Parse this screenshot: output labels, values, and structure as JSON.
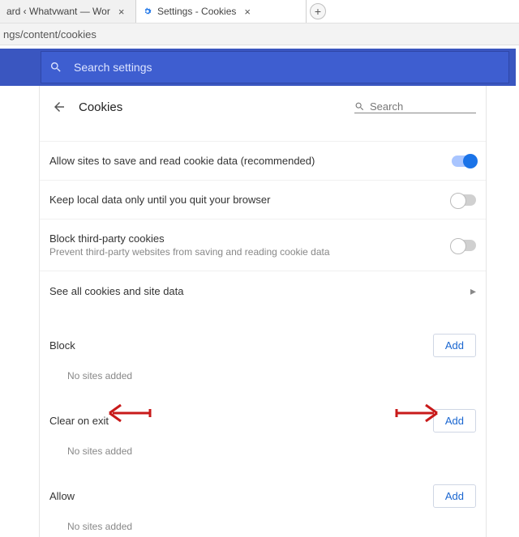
{
  "tabs": {
    "t0": {
      "title": "ard ‹ Whatvwant — Wor"
    },
    "t1": {
      "title": "Settings - Cookies"
    }
  },
  "urlbar": {
    "path": "ngs/content/cookies"
  },
  "band": {
    "placeholder": "Search settings"
  },
  "page": {
    "back": "←",
    "title": "Cookies",
    "search_placeholder": "Search"
  },
  "rows": {
    "r0": {
      "label": "Allow sites to save and read cookie data (recommended)"
    },
    "r1": {
      "label": "Keep local data only until you quit your browser"
    },
    "r2": {
      "label": "Block third-party cookies",
      "sub": "Prevent third-party websites from saving and reading cookie data"
    },
    "r3": {
      "label": "See all cookies and site data"
    }
  },
  "sections": {
    "block": {
      "title": "Block",
      "add": "Add",
      "empty": "No sites added"
    },
    "clear": {
      "title": "Clear on exit",
      "add": "Add",
      "empty": "No sites added"
    },
    "allow": {
      "title": "Allow",
      "add": "Add",
      "empty": "No sites added"
    }
  }
}
